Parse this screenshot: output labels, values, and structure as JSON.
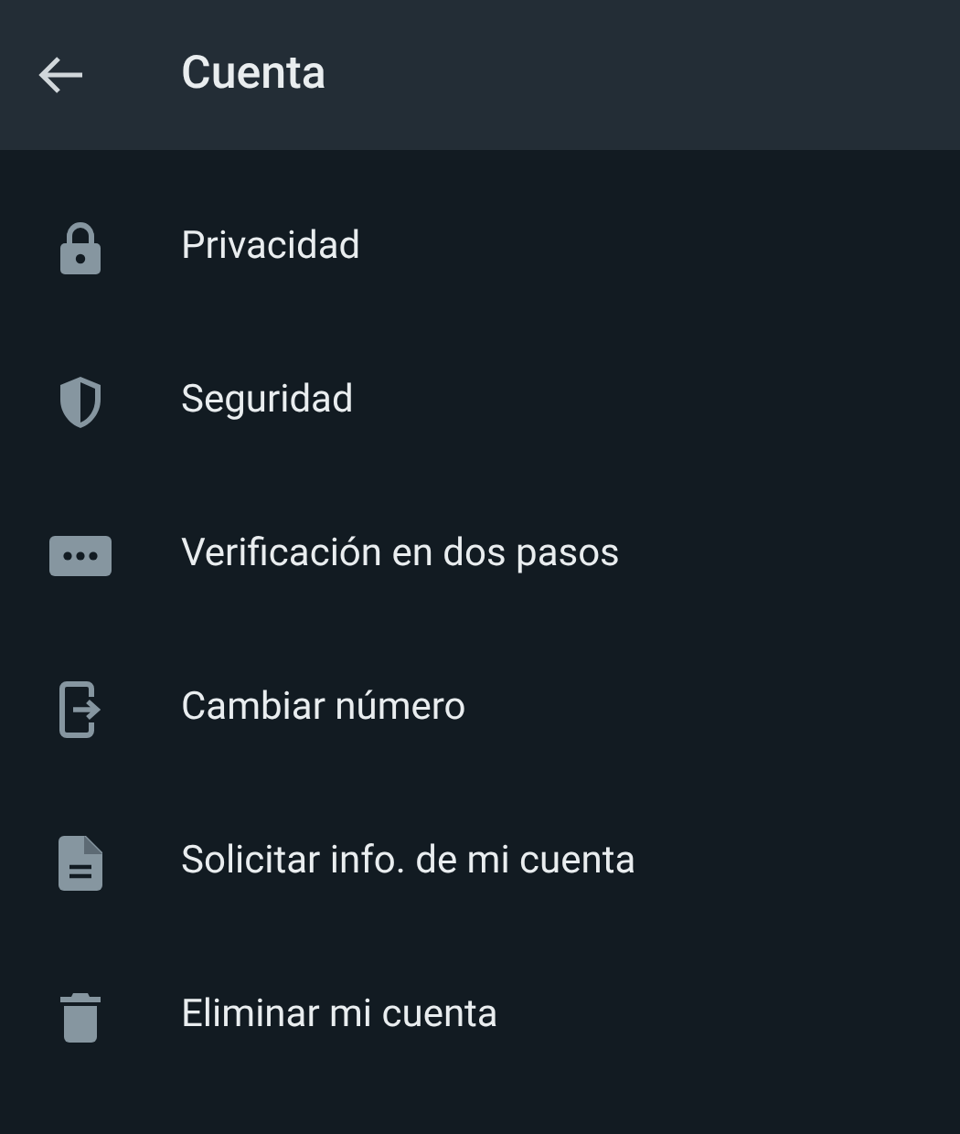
{
  "header": {
    "title": "Cuenta"
  },
  "items": [
    {
      "kind": "lock",
      "label": "Privacidad"
    },
    {
      "kind": "shield",
      "label": "Seguridad"
    },
    {
      "kind": "dots",
      "label": "Verificación en dos pasos"
    },
    {
      "kind": "phone",
      "label": "Cambiar número"
    },
    {
      "kind": "document",
      "label": "Solicitar info. de mi cuenta"
    },
    {
      "kind": "trash",
      "label": "Eliminar mi cuenta"
    }
  ]
}
